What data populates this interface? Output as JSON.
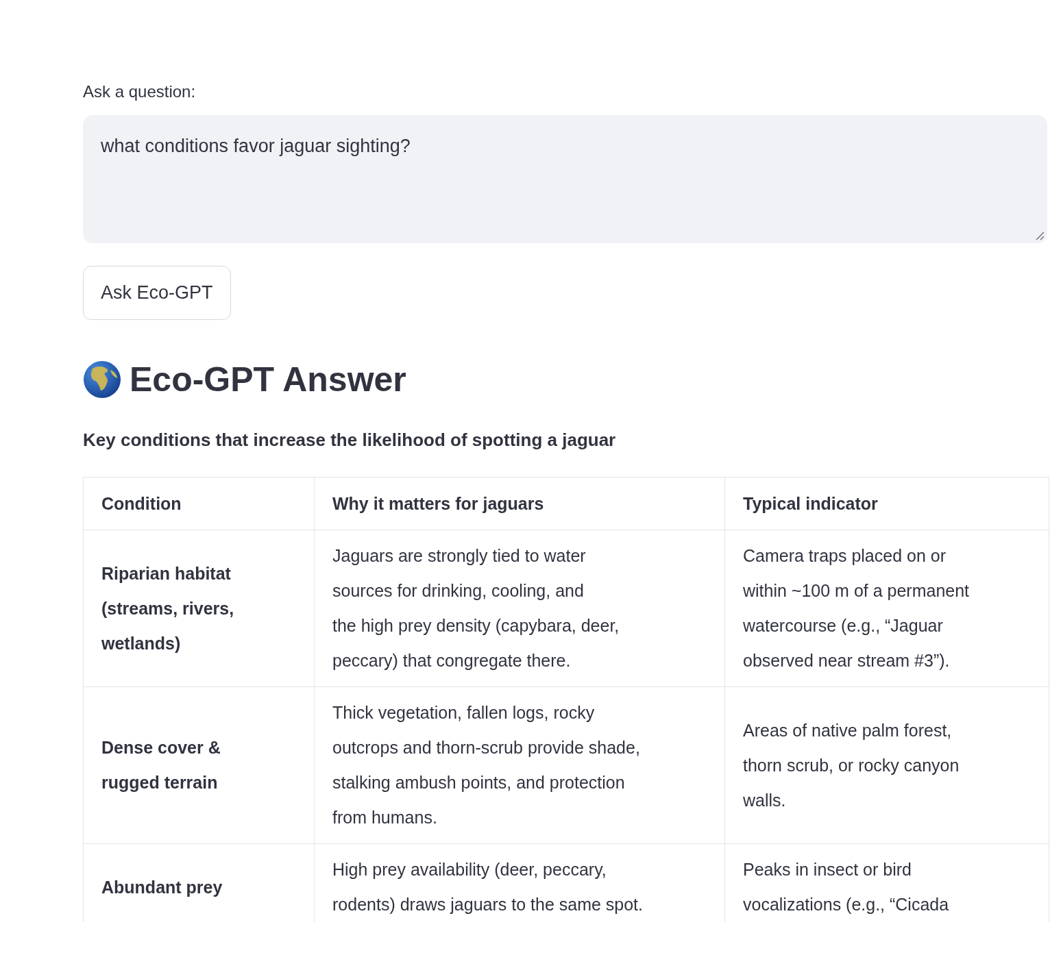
{
  "question": {
    "label": "Ask a question:",
    "value": "what conditions favor jaguar sighting?"
  },
  "ask_button": "Ask Eco-GPT",
  "answer": {
    "title": "Eco-GPT Answer",
    "subtitle": "Key conditions that increase the likelihood of spotting a jaguar"
  },
  "table": {
    "columns": [
      "Condition",
      "Why it matters for jaguars",
      "Typical indicator"
    ],
    "rows": [
      {
        "cells": [
          [
            "Riparian habitat",
            "(streams, rivers,",
            "wetlands)"
          ],
          [
            "Jaguars are strongly tied to water",
            "sources for drinking, cooling, and",
            "the high prey density (capybara, deer,",
            "peccary) that congregate there."
          ],
          [
            "Camera traps placed on or",
            "within ~100 m of a permanent",
            "watercourse (e.g., “Jaguar",
            "observed near stream #3”)."
          ]
        ]
      },
      {
        "cells": [
          [
            "Dense cover &",
            "rugged terrain"
          ],
          [
            "Thick vegetation, fallen logs, rocky",
            "outcrops and thorn-scrub provide shade,",
            "stalking ambush points, and protection",
            "from humans."
          ],
          [
            "Areas of native palm forest,",
            "thorn scrub, or rocky canyon",
            "walls."
          ]
        ]
      },
      {
        "cells": [
          [
            "Abundant prey"
          ],
          [
            "High prey availability (deer, peccary,",
            "rodents) draws jaguars to the same spot."
          ],
          [
            "Peaks in insect or bird",
            "vocalizations (e.g., “Cicada"
          ]
        ]
      }
    ]
  }
}
